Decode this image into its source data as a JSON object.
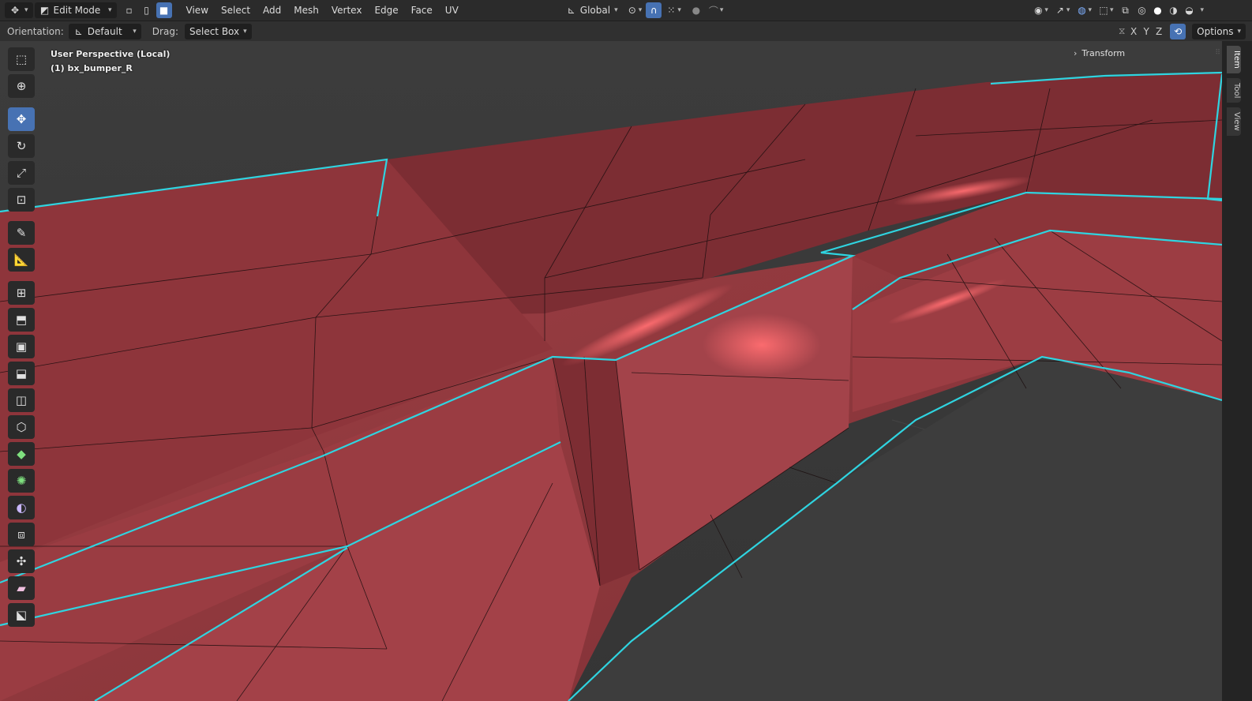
{
  "header": {
    "mode_label": "Edit Mode",
    "menus": [
      "View",
      "Select",
      "Add",
      "Mesh",
      "Vertex",
      "Edge",
      "Face",
      "UV"
    ],
    "transform_orientation": "Global"
  },
  "tool_settings": {
    "orientation_label": "Orientation:",
    "orientation_value": "Default",
    "drag_label": "Drag:",
    "drag_value": "Select Box",
    "axes": [
      "X",
      "Y",
      "Z"
    ],
    "options_label": "Options"
  },
  "viewport": {
    "perspective_text": "User Perspective (Local)",
    "object_text": "(1) bx_bumper_R",
    "transform_panel_label": "Transform",
    "mesh_color": "#a3444a",
    "edge_highlight_color": "#2fd4e0"
  },
  "toolbar": {
    "tools": [
      "select-box",
      "cursor",
      "move",
      "rotate",
      "scale",
      "transform",
      "annotate",
      "measure",
      "add-cube",
      "extrude-region",
      "inset-faces",
      "bevel",
      "loop-cut",
      "knife",
      "poly-build",
      "spin",
      "smooth",
      "edge-slide",
      "shrink-fatten",
      "shear",
      "rip-region"
    ],
    "active_tool": "move"
  },
  "sidebar_tabs": [
    "Item",
    "Tool",
    "View"
  ]
}
